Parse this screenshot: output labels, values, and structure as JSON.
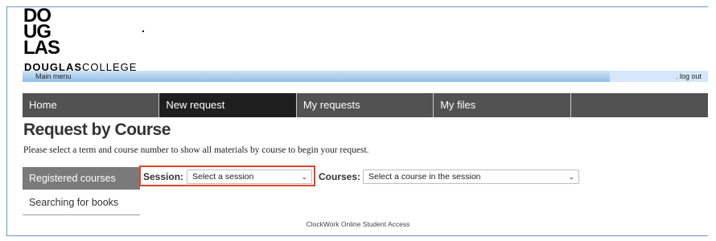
{
  "logo": {
    "lines": [
      "DO",
      "UG",
      "LAS"
    ],
    "word_bold": "DOUGLAS",
    "word_light": "COLLEGE"
  },
  "menubar": {
    "main_menu": "Main menu",
    "logout": ". log out"
  },
  "nav": {
    "items": [
      "Home",
      "New request",
      "My requests",
      "My files",
      ""
    ],
    "active": "New request"
  },
  "page": {
    "title": "Request by Course",
    "instructions": "Please select a term and course number to show all materials by course to begin your request."
  },
  "side_menu": {
    "items": [
      "Registered courses",
      "Searching for books"
    ],
    "active": "Registered courses"
  },
  "form": {
    "session_label": "Session:",
    "session_value": "Select a session",
    "courses_label": "Courses:",
    "courses_value": "Select a course in the session"
  },
  "footer": {
    "text": "ClockWork Online Student Access"
  },
  "colors": {
    "nav_bg": "#525252",
    "nav_active": "#1f1f1f",
    "highlight": "#e0442a",
    "menubar": "#8fbfe6"
  }
}
